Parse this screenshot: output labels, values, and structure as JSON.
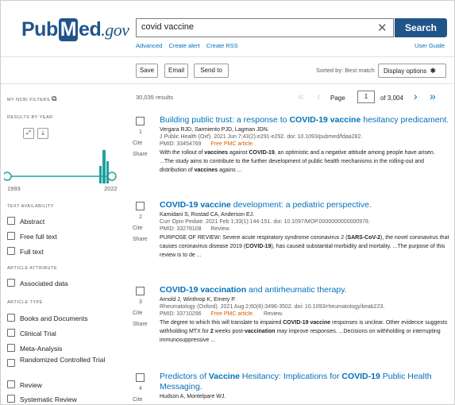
{
  "header": {
    "logo_pre": "Pub",
    "logo_m": "M",
    "logo_post": "ed",
    "logo_gov": ".gov",
    "search_value": "covid vaccine",
    "search_button": "Search",
    "links": [
      "Advanced",
      "Create alert",
      "Create RSS"
    ],
    "user_guide": "User Guide"
  },
  "toolbar": {
    "save": "Save",
    "email": "Email",
    "send_to": "Send to",
    "sorted": "Sorted by: Best match",
    "display_options": "Display options"
  },
  "sidebar": {
    "my_filters": "MY NCBI FILTERS",
    "results_by_year": "RESULTS BY YEAR",
    "year_start": "1993",
    "year_end": "2022",
    "text_availability": "TEXT AVAILABILITY",
    "text_items": [
      "Abstract",
      "Free full text",
      "Full text"
    ],
    "article_attribute": "ARTICLE ATTRIBUTE",
    "attribute_items": [
      "Associated data"
    ],
    "article_type": "ARTICLE TYPE",
    "type_items": [
      "Books and Documents",
      "Clinical Trial",
      "Meta-Analysis",
      "Randomized Controlled Trial",
      "Review",
      "Systematic Review"
    ]
  },
  "results": {
    "count": "30,035 results",
    "page_label": "Page",
    "page_value": "1",
    "of_pages": "of 3,004",
    "cite": "Cite",
    "share": "Share",
    "items": [
      {
        "num": "1",
        "authors": "Vergara RJD, Sarmiento PJD, Lagman JDN.",
        "citation": "J Public Health (Oxf). 2021 Jun 7;43(2):e291-e292. doi: 10.1093/pubmed/fdaa282.",
        "pmid": "PMID: 33454769",
        "tag": "Free PMC article."
      },
      {
        "num": "2",
        "authors": "Kamidani S, Rostad CA, Anderson EJ.",
        "citation": "Curr Opin Pediatr. 2021 Feb 1;33(1):144-151. doi: 10.1097/MOP.0000000000000978.",
        "pmid": "PMID: 33278108",
        "tag": "Review."
      },
      {
        "num": "3",
        "authors": "Arnold J, Winthrop K, Emery P.",
        "citation": "Rheumatology (Oxford). 2021 Aug 2;60(8):3496-3502. doi: 10.1093/rheumatology/keab223.",
        "pmid": "PMID: 33710296",
        "tag": "Free PMC article.",
        "tag2": "Review."
      },
      {
        "num": "4",
        "authors": "Hudson A, Montelpare WJ."
      }
    ]
  }
}
